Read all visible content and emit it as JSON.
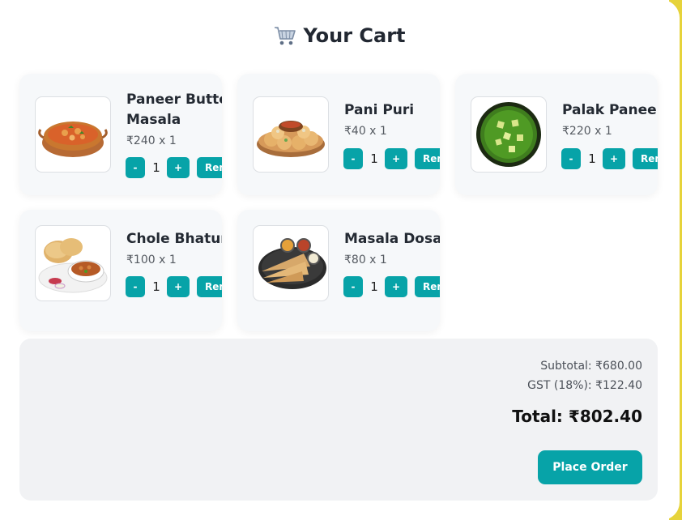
{
  "header": {
    "title": "Your Cart",
    "icon": "shopping-cart-icon"
  },
  "items": [
    {
      "name": "Paneer Butter Masala",
      "price": "₹240 x 1",
      "qty": "1",
      "minus": "-",
      "plus": "+",
      "remove": "Remove",
      "image": "paneer-butter-masala-image"
    },
    {
      "name": "Pani Puri",
      "price": "₹40 x 1",
      "qty": "1",
      "minus": "-",
      "plus": "+",
      "remove": "Remove",
      "image": "pani-puri-image"
    },
    {
      "name": "Palak Paneer",
      "price": "₹220 x 1",
      "qty": "1",
      "minus": "-",
      "plus": "+",
      "remove": "Remove",
      "image": "palak-paneer-image"
    },
    {
      "name": "Chole Bhature",
      "price": "₹100 x 1",
      "qty": "1",
      "minus": "-",
      "plus": "+",
      "remove": "Remove",
      "image": "chole-bhature-image"
    },
    {
      "name": "Masala Dosa",
      "price": "₹80 x 1",
      "qty": "1",
      "minus": "-",
      "plus": "+",
      "remove": "Remove",
      "image": "masala-dosa-image"
    }
  ],
  "summary": {
    "subtotal": "Subtotal: ₹680.00",
    "gst": "GST (18%): ₹122.40",
    "total": "Total: ₹802.40",
    "place_order": "Place Order"
  },
  "colors": {
    "accent": "#07a3a8",
    "card_bg": "#f6f8fa",
    "summary_bg": "#f1f2f4",
    "frame": "#e6d33a"
  }
}
